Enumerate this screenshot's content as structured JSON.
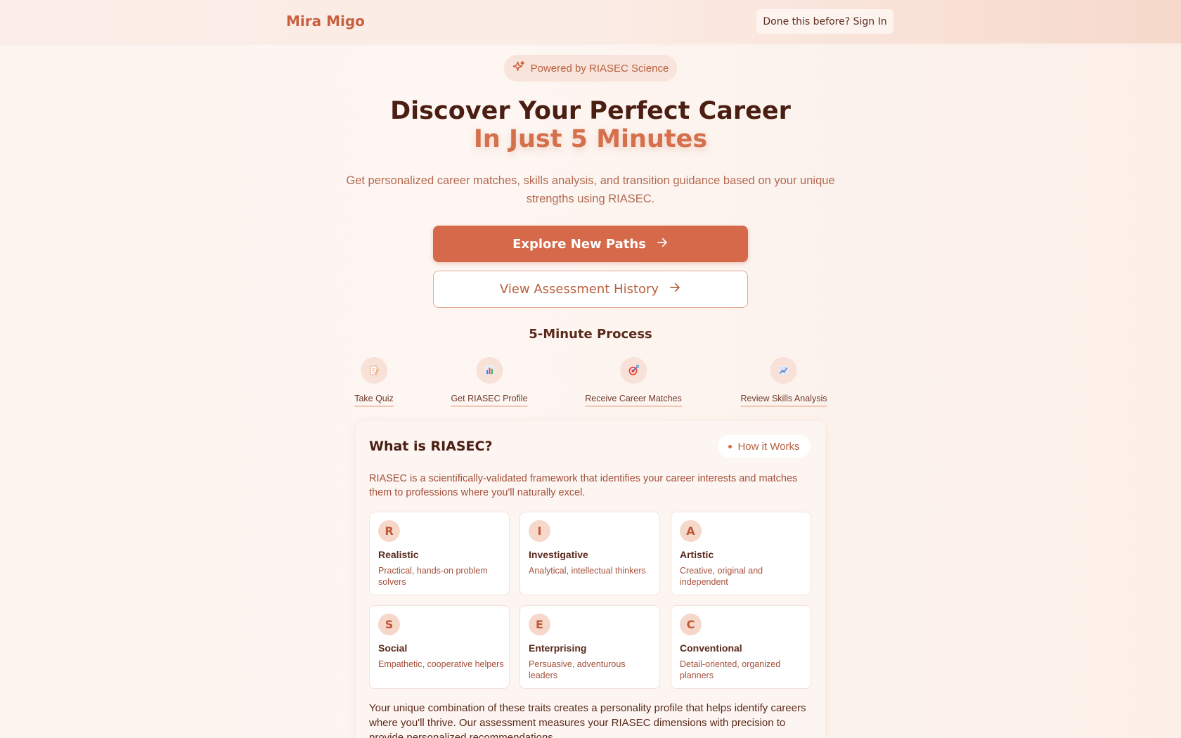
{
  "header": {
    "brand": "Mira Migo",
    "signin_label": "Done this before? Sign In"
  },
  "hero": {
    "badge_label": "Powered by RIASEC Science",
    "title_line1": "Discover Your Perfect Career",
    "title_line2": "In Just 5 Minutes",
    "subtitle": "Get personalized career matches, skills analysis, and transition guidance based on your unique strengths using RIASEC.",
    "primary_button": "Explore New Paths",
    "secondary_button": "View Assessment History"
  },
  "process": {
    "title": "5-Minute Process",
    "steps": [
      {
        "label": "Take Quiz",
        "icon": "memo-icon"
      },
      {
        "label": "Get RIASEC Profile",
        "icon": "bar-chart-icon"
      },
      {
        "label": "Receive Career Matches",
        "icon": "target-icon"
      },
      {
        "label": "Review Skills Analysis",
        "icon": "trend-chart-icon"
      }
    ]
  },
  "riasec": {
    "title": "What is RIASEC?",
    "how_label": "How it Works",
    "description": "RIASEC is a scientifically-validated framework that identifies your career interests and matches them to professions where you'll naturally excel.",
    "traits": [
      {
        "letter": "R",
        "name": "Realistic",
        "desc": "Practical, hands-on problem solvers"
      },
      {
        "letter": "I",
        "name": "Investigative",
        "desc": "Analytical, intellectual thinkers"
      },
      {
        "letter": "A",
        "name": "Artistic",
        "desc": "Creative, original and independent"
      },
      {
        "letter": "S",
        "name": "Social",
        "desc": "Empathetic, cooperative helpers"
      },
      {
        "letter": "E",
        "name": "Enterprising",
        "desc": "Persuasive, adventurous leaders"
      },
      {
        "letter": "C",
        "name": "Conventional",
        "desc": "Detail-oriented, organized planners"
      }
    ],
    "footer": "Your unique combination of these traits creates a personality profile that helps identify careers where you'll thrive. Our assessment measures your RIASEC dimensions with precision to provide personalized recommendations."
  },
  "colors": {
    "accent": "#d5694a",
    "brand": "#c8603f",
    "heading": "#4a1e12"
  }
}
